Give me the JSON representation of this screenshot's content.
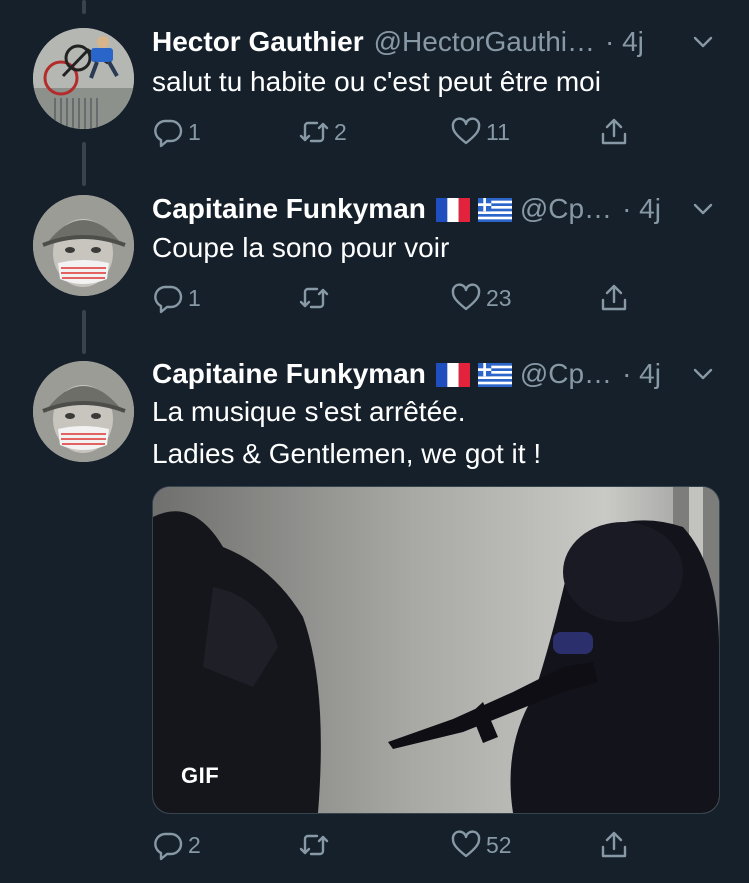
{
  "tweets": [
    {
      "name": "Hector Gauthier",
      "handle": "@HectorGauthi…",
      "time": "· 4j",
      "text": [
        "salut tu habite ou c'est peut être moi"
      ],
      "replies": "1",
      "retweets": "2",
      "likes": "11",
      "flags": []
    },
    {
      "name": "Capitaine Funkyman",
      "handle": "@Cp…",
      "time": "· 4j",
      "text": [
        "Coupe la sono pour voir"
      ],
      "replies": "1",
      "retweets": "",
      "likes": "23",
      "flags": [
        "france-flag",
        "greece-flag"
      ]
    },
    {
      "name": "Capitaine Funkyman",
      "handle": "@Cp…",
      "time": "· 4j",
      "text": [
        "La musique s'est arrêtée.",
        "Ladies & Gentlemen, we got it !"
      ],
      "replies": "2",
      "retweets": "",
      "likes": "52",
      "flags": [
        "france-flag",
        "greece-flag"
      ],
      "media": {
        "badge": "GIF"
      }
    }
  ],
  "icons": {
    "reply": "reply-icon",
    "retweet": "retweet-icon",
    "like": "heart-icon",
    "share": "share-icon",
    "more": "chevron-down-icon"
  },
  "colors": {
    "background": "#15202b",
    "secondary_text": "#8899a6",
    "thread_line": "#38444d",
    "primary_text": "#ffffff"
  }
}
